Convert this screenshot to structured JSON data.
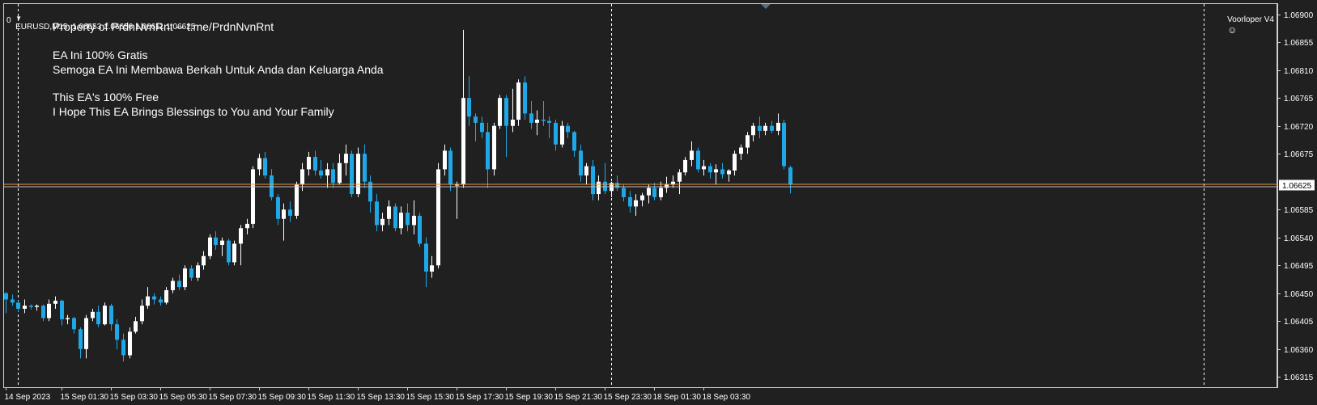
{
  "header": {
    "symbol_text": "EURUSD,M15  1.06653 1.06656 1.06611 1.06625",
    "zero_label": "0",
    "expert_label": "Voorloper V4",
    "smiley_icon": "smiley-face-icon",
    "menu_icon": "triangle-down-icon"
  },
  "overlay": {
    "line1": "Property of PrdnNvnRnt -- t.me/PrdnNvnRnt",
    "line2": "EA Ini 100% Gratis",
    "line3": "Semoga EA Ini Membawa Berkah Untuk Anda dan Keluarga Anda",
    "line4": "This EA's 100% Free",
    "line5": "I Hope This EA Brings Blessings to You and Your Family"
  },
  "colors": {
    "background": "#202020",
    "bull": "#ffffff",
    "bear": "#1fa8e8",
    "grid_line": "#ffffff",
    "bid_line": "#e8963b",
    "price_tag_bg": "#ffffff"
  },
  "chart_data": {
    "type": "candlestick",
    "symbol": "EURUSD",
    "timeframe": "M15",
    "ohlc_last": {
      "open": 1.06653,
      "high": 1.06656,
      "low": 1.06611,
      "close": 1.06625
    },
    "current_price": 1.06625,
    "current_price_label": "1.06625",
    "ylim": [
      1.06305,
      1.0691
    ],
    "y_ticks": [
      1.069,
      1.06855,
      1.0681,
      1.06765,
      1.0672,
      1.06675,
      1.06585,
      1.0654,
      1.06495,
      1.0645,
      1.06405,
      1.0636,
      1.06315
    ],
    "y_tick_labels": [
      "1.06900",
      "1.06855",
      "1.06810",
      "1.06765",
      "1.06720",
      "1.06675",
      "1.06585",
      "1.06540",
      "1.06495",
      "1.06450",
      "1.06405",
      "1.06360",
      "1.06315"
    ],
    "x_tick_labels": [
      "14 Sep 2023",
      "15 Sep 01:30",
      "15 Sep 03:30",
      "15 Sep 05:30",
      "15 Sep 07:30",
      "15 Sep 09:30",
      "15 Sep 11:30",
      "15 Sep 13:30",
      "15 Sep 15:30",
      "15 Sep 17:30",
      "15 Sep 19:30",
      "15 Sep 21:30",
      "15 Sep 23:30",
      "18 Sep 01:30",
      "18 Sep 03:30"
    ],
    "x_tick_candle_index": [
      0,
      9,
      17,
      25,
      33,
      41,
      49,
      57,
      65,
      73,
      81,
      89,
      97,
      105,
      113
    ],
    "vertical_dashed_line_candle_index": [
      2,
      98,
      194
    ],
    "grid": false,
    "candles": [
      {
        "o": 1.0645,
        "h": 1.06452,
        "l": 1.06418,
        "c": 1.0644
      },
      {
        "o": 1.0644,
        "h": 1.06448,
        "l": 1.0643,
        "c": 1.06435
      },
      {
        "o": 1.06435,
        "h": 1.06438,
        "l": 1.0642,
        "c": 1.06425
      },
      {
        "o": 1.06425,
        "h": 1.0644,
        "l": 1.06418,
        "c": 1.0643
      },
      {
        "o": 1.0643,
        "h": 1.06432,
        "l": 1.06424,
        "c": 1.06428
      },
      {
        "o": 1.06428,
        "h": 1.06432,
        "l": 1.06422,
        "c": 1.0643
      },
      {
        "o": 1.0643,
        "h": 1.06432,
        "l": 1.06405,
        "c": 1.0641
      },
      {
        "o": 1.0641,
        "h": 1.0644,
        "l": 1.06405,
        "c": 1.06433
      },
      {
        "o": 1.06433,
        "h": 1.06445,
        "l": 1.06425,
        "c": 1.06438
      },
      {
        "o": 1.06438,
        "h": 1.0644,
        "l": 1.06398,
        "c": 1.06408
      },
      {
        "o": 1.06408,
        "h": 1.06415,
        "l": 1.064,
        "c": 1.0641
      },
      {
        "o": 1.0641,
        "h": 1.06412,
        "l": 1.06385,
        "c": 1.06392
      },
      {
        "o": 1.06392,
        "h": 1.06395,
        "l": 1.06345,
        "c": 1.0636
      },
      {
        "o": 1.0636,
        "h": 1.06415,
        "l": 1.06345,
        "c": 1.0641
      },
      {
        "o": 1.0641,
        "h": 1.06425,
        "l": 1.06405,
        "c": 1.0642
      },
      {
        "o": 1.0642,
        "h": 1.0643,
        "l": 1.06395,
        "c": 1.064
      },
      {
        "o": 1.064,
        "h": 1.06435,
        "l": 1.06398,
        "c": 1.0643
      },
      {
        "o": 1.0643,
        "h": 1.06433,
        "l": 1.0639,
        "c": 1.064
      },
      {
        "o": 1.064,
        "h": 1.06408,
        "l": 1.0636,
        "c": 1.06375
      },
      {
        "o": 1.06375,
        "h": 1.06385,
        "l": 1.0634,
        "c": 1.0635
      },
      {
        "o": 1.0635,
        "h": 1.06395,
        "l": 1.06345,
        "c": 1.06388
      },
      {
        "o": 1.06388,
        "h": 1.06412,
        "l": 1.06385,
        "c": 1.06405
      },
      {
        "o": 1.06405,
        "h": 1.0644,
        "l": 1.064,
        "c": 1.0643
      },
      {
        "o": 1.0643,
        "h": 1.0646,
        "l": 1.06425,
        "c": 1.06445
      },
      {
        "o": 1.06445,
        "h": 1.0645,
        "l": 1.06432,
        "c": 1.0644
      },
      {
        "o": 1.0644,
        "h": 1.06445,
        "l": 1.0643,
        "c": 1.06435
      },
      {
        "o": 1.06435,
        "h": 1.0646,
        "l": 1.06432,
        "c": 1.06455
      },
      {
        "o": 1.06455,
        "h": 1.06475,
        "l": 1.0645,
        "c": 1.0647
      },
      {
        "o": 1.0647,
        "h": 1.0648,
        "l": 1.06455,
        "c": 1.0646
      },
      {
        "o": 1.0646,
        "h": 1.06495,
        "l": 1.06455,
        "c": 1.0649
      },
      {
        "o": 1.0649,
        "h": 1.06495,
        "l": 1.0647,
        "c": 1.06475
      },
      {
        "o": 1.06475,
        "h": 1.065,
        "l": 1.0647,
        "c": 1.06495
      },
      {
        "o": 1.06495,
        "h": 1.06518,
        "l": 1.06488,
        "c": 1.0651
      },
      {
        "o": 1.0651,
        "h": 1.06545,
        "l": 1.06505,
        "c": 1.0654
      },
      {
        "o": 1.0654,
        "h": 1.0655,
        "l": 1.0652,
        "c": 1.06528
      },
      {
        "o": 1.06528,
        "h": 1.0654,
        "l": 1.0651,
        "c": 1.06535
      },
      {
        "o": 1.06535,
        "h": 1.06538,
        "l": 1.06495,
        "c": 1.065
      },
      {
        "o": 1.065,
        "h": 1.06535,
        "l": 1.06495,
        "c": 1.0653
      },
      {
        "o": 1.0653,
        "h": 1.0656,
        "l": 1.06495,
        "c": 1.06555
      },
      {
        "o": 1.06555,
        "h": 1.0657,
        "l": 1.06545,
        "c": 1.06562
      },
      {
        "o": 1.06562,
        "h": 1.06655,
        "l": 1.06555,
        "c": 1.0665
      },
      {
        "o": 1.0665,
        "h": 1.06675,
        "l": 1.0664,
        "c": 1.06668
      },
      {
        "o": 1.06668,
        "h": 1.06678,
        "l": 1.06635,
        "c": 1.0664
      },
      {
        "o": 1.0664,
        "h": 1.0665,
        "l": 1.066,
        "c": 1.06605
      },
      {
        "o": 1.06605,
        "h": 1.0661,
        "l": 1.0656,
        "c": 1.0657
      },
      {
        "o": 1.0657,
        "h": 1.06595,
        "l": 1.06535,
        "c": 1.06585
      },
      {
        "o": 1.06585,
        "h": 1.06598,
        "l": 1.06565,
        "c": 1.06575
      },
      {
        "o": 1.06575,
        "h": 1.0663,
        "l": 1.0657,
        "c": 1.06625
      },
      {
        "o": 1.06625,
        "h": 1.0666,
        "l": 1.06615,
        "c": 1.0665
      },
      {
        "o": 1.0665,
        "h": 1.06678,
        "l": 1.0664,
        "c": 1.0667
      },
      {
        "o": 1.0667,
        "h": 1.0668,
        "l": 1.0664,
        "c": 1.06648
      },
      {
        "o": 1.06648,
        "h": 1.06665,
        "l": 1.06635,
        "c": 1.0664
      },
      {
        "o": 1.0664,
        "h": 1.0666,
        "l": 1.0662,
        "c": 1.0665
      },
      {
        "o": 1.0665,
        "h": 1.0666,
        "l": 1.0662,
        "c": 1.06628
      },
      {
        "o": 1.06628,
        "h": 1.06675,
        "l": 1.06625,
        "c": 1.0666
      },
      {
        "o": 1.0666,
        "h": 1.0669,
        "l": 1.0664,
        "c": 1.06675
      },
      {
        "o": 1.06675,
        "h": 1.0668,
        "l": 1.06605,
        "c": 1.0661
      },
      {
        "o": 1.0661,
        "h": 1.06685,
        "l": 1.06605,
        "c": 1.06675
      },
      {
        "o": 1.06675,
        "h": 1.0669,
        "l": 1.0662,
        "c": 1.0663
      },
      {
        "o": 1.0663,
        "h": 1.0664,
        "l": 1.0658,
        "c": 1.06598
      },
      {
        "o": 1.06598,
        "h": 1.0661,
        "l": 1.0655,
        "c": 1.0656
      },
      {
        "o": 1.0656,
        "h": 1.0658,
        "l": 1.0655,
        "c": 1.0657
      },
      {
        "o": 1.0657,
        "h": 1.066,
        "l": 1.0656,
        "c": 1.0659
      },
      {
        "o": 1.0659,
        "h": 1.06595,
        "l": 1.0655,
        "c": 1.06555
      },
      {
        "o": 1.06555,
        "h": 1.0659,
        "l": 1.06545,
        "c": 1.0658
      },
      {
        "o": 1.0658,
        "h": 1.06595,
        "l": 1.0655,
        "c": 1.0656
      },
      {
        "o": 1.0656,
        "h": 1.066,
        "l": 1.06545,
        "c": 1.06575
      },
      {
        "o": 1.06575,
        "h": 1.0658,
        "l": 1.06525,
        "c": 1.0653
      },
      {
        "o": 1.0653,
        "h": 1.0654,
        "l": 1.0646,
        "c": 1.06485
      },
      {
        "o": 1.06485,
        "h": 1.0651,
        "l": 1.06475,
        "c": 1.06495
      },
      {
        "o": 1.06495,
        "h": 1.0666,
        "l": 1.0649,
        "c": 1.0665
      },
      {
        "o": 1.0665,
        "h": 1.0669,
        "l": 1.0664,
        "c": 1.0668
      },
      {
        "o": 1.0668,
        "h": 1.06685,
        "l": 1.06615,
        "c": 1.06625
      },
      {
        "o": 1.06625,
        "h": 1.0663,
        "l": 1.0657,
        "c": 1.06625
      },
      {
        "o": 1.06625,
        "h": 1.06875,
        "l": 1.0662,
        "c": 1.06765
      },
      {
        "o": 1.06765,
        "h": 1.068,
        "l": 1.0672,
        "c": 1.06735
      },
      {
        "o": 1.06735,
        "h": 1.0674,
        "l": 1.06695,
        "c": 1.06725
      },
      {
        "o": 1.06725,
        "h": 1.06735,
        "l": 1.067,
        "c": 1.0671
      },
      {
        "o": 1.0671,
        "h": 1.06725,
        "l": 1.0662,
        "c": 1.0665
      },
      {
        "o": 1.0665,
        "h": 1.06725,
        "l": 1.0664,
        "c": 1.0672
      },
      {
        "o": 1.0672,
        "h": 1.0677,
        "l": 1.06715,
        "c": 1.06765
      },
      {
        "o": 1.06765,
        "h": 1.0677,
        "l": 1.0667,
        "c": 1.0672
      },
      {
        "o": 1.0672,
        "h": 1.0678,
        "l": 1.0671,
        "c": 1.0673
      },
      {
        "o": 1.0673,
        "h": 1.06795,
        "l": 1.0672,
        "c": 1.0679
      },
      {
        "o": 1.0679,
        "h": 1.068,
        "l": 1.0673,
        "c": 1.0674
      },
      {
        "o": 1.0674,
        "h": 1.0676,
        "l": 1.06715,
        "c": 1.06725
      },
      {
        "o": 1.06725,
        "h": 1.06745,
        "l": 1.06705,
        "c": 1.0673
      },
      {
        "o": 1.0673,
        "h": 1.0676,
        "l": 1.0672,
        "c": 1.06728
      },
      {
        "o": 1.06728,
        "h": 1.06735,
        "l": 1.067,
        "c": 1.06725
      },
      {
        "o": 1.06725,
        "h": 1.0673,
        "l": 1.0668,
        "c": 1.0669
      },
      {
        "o": 1.0669,
        "h": 1.06728,
        "l": 1.06685,
        "c": 1.0672
      },
      {
        "o": 1.0672,
        "h": 1.06725,
        "l": 1.067,
        "c": 1.0671
      },
      {
        "o": 1.0671,
        "h": 1.06712,
        "l": 1.0667,
        "c": 1.0668
      },
      {
        "o": 1.0668,
        "h": 1.0669,
        "l": 1.0663,
        "c": 1.0664
      },
      {
        "o": 1.0664,
        "h": 1.0666,
        "l": 1.06625,
        "c": 1.06655
      },
      {
        "o": 1.06655,
        "h": 1.06665,
        "l": 1.066,
        "c": 1.0661
      },
      {
        "o": 1.0661,
        "h": 1.0664,
        "l": 1.066,
        "c": 1.0663
      },
      {
        "o": 1.0663,
        "h": 1.0666,
        "l": 1.0661,
        "c": 1.06615
      },
      {
        "o": 1.06615,
        "h": 1.0663,
        "l": 1.06605,
        "c": 1.06628
      },
      {
        "o": 1.06628,
        "h": 1.0664,
        "l": 1.06615,
        "c": 1.0662
      },
      {
        "o": 1.0662,
        "h": 1.06625,
        "l": 1.06598,
        "c": 1.06605
      },
      {
        "o": 1.06605,
        "h": 1.06615,
        "l": 1.0658,
        "c": 1.0659
      },
      {
        "o": 1.0659,
        "h": 1.0661,
        "l": 1.06575,
        "c": 1.066
      },
      {
        "o": 1.066,
        "h": 1.06612,
        "l": 1.0659,
        "c": 1.06608
      },
      {
        "o": 1.06608,
        "h": 1.06625,
        "l": 1.06595,
        "c": 1.0662
      },
      {
        "o": 1.0662,
        "h": 1.06628,
        "l": 1.066,
        "c": 1.06605
      },
      {
        "o": 1.06605,
        "h": 1.0663,
        "l": 1.066,
        "c": 1.0662
      },
      {
        "o": 1.0662,
        "h": 1.06638,
        "l": 1.06612,
        "c": 1.06625
      },
      {
        "o": 1.06625,
        "h": 1.0664,
        "l": 1.0662,
        "c": 1.0663
      },
      {
        "o": 1.0663,
        "h": 1.0665,
        "l": 1.0661,
        "c": 1.06645
      },
      {
        "o": 1.06645,
        "h": 1.0667,
        "l": 1.0664,
        "c": 1.06665
      },
      {
        "o": 1.06665,
        "h": 1.06695,
        "l": 1.06655,
        "c": 1.0668
      },
      {
        "o": 1.0668,
        "h": 1.06685,
        "l": 1.06645,
        "c": 1.0665
      },
      {
        "o": 1.0665,
        "h": 1.06665,
        "l": 1.0664,
        "c": 1.06655
      },
      {
        "o": 1.06655,
        "h": 1.0666,
        "l": 1.06635,
        "c": 1.06645
      },
      {
        "o": 1.06645,
        "h": 1.06658,
        "l": 1.06625,
        "c": 1.0665
      },
      {
        "o": 1.0665,
        "h": 1.0666,
        "l": 1.06635,
        "c": 1.06642
      },
      {
        "o": 1.06642,
        "h": 1.0665,
        "l": 1.0663,
        "c": 1.06648
      },
      {
        "o": 1.06648,
        "h": 1.0668,
        "l": 1.0664,
        "c": 1.06675
      },
      {
        "o": 1.06675,
        "h": 1.0669,
        "l": 1.06665,
        "c": 1.06685
      },
      {
        "o": 1.06685,
        "h": 1.0671,
        "l": 1.06675,
        "c": 1.06705
      },
      {
        "o": 1.06705,
        "h": 1.06725,
        "l": 1.06695,
        "c": 1.0672
      },
      {
        "o": 1.0672,
        "h": 1.06735,
        "l": 1.067,
        "c": 1.06712
      },
      {
        "o": 1.06712,
        "h": 1.06725,
        "l": 1.06705,
        "c": 1.0672
      },
      {
        "o": 1.0672,
        "h": 1.06728,
        "l": 1.06708,
        "c": 1.06712
      },
      {
        "o": 1.06712,
        "h": 1.0674,
        "l": 1.06705,
        "c": 1.06725
      },
      {
        "o": 1.06725,
        "h": 1.0673,
        "l": 1.0665,
        "c": 1.06655
      },
      {
        "o": 1.06653,
        "h": 1.06656,
        "l": 1.06611,
        "c": 1.06625
      }
    ]
  }
}
